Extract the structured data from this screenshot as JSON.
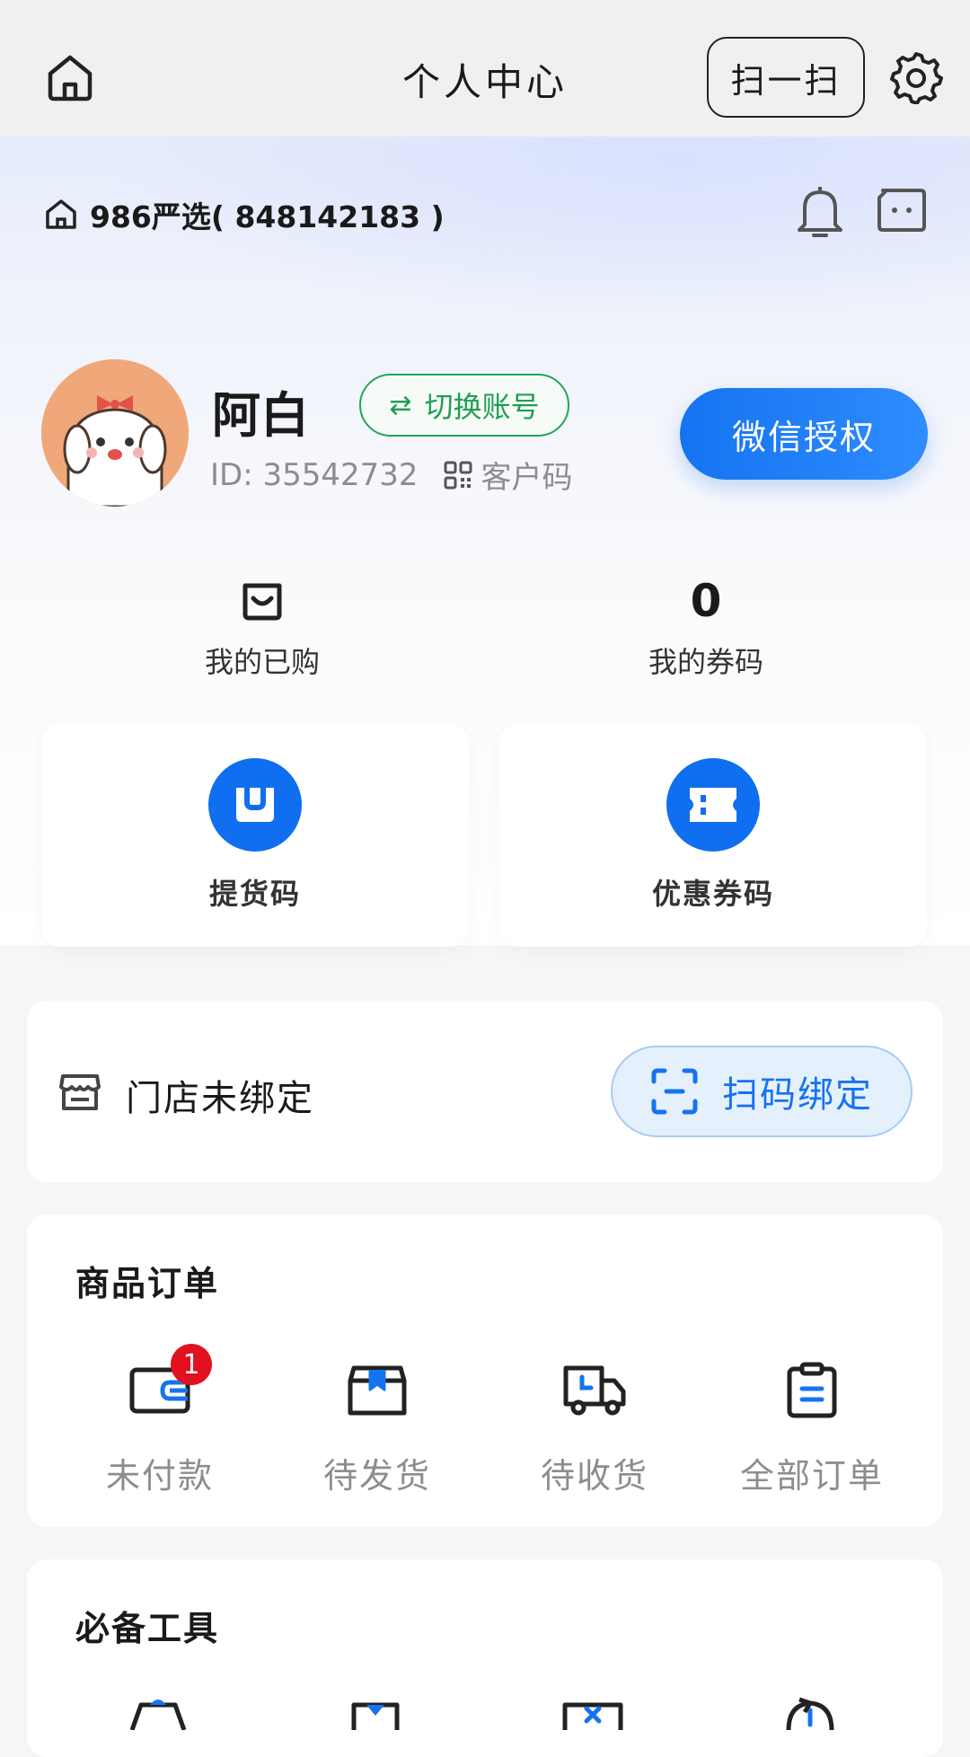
{
  "header": {
    "title": "个人中心",
    "scan_label": "扫一扫"
  },
  "shop": {
    "name": "986严选( 848142183 )"
  },
  "profile": {
    "name": "阿白",
    "switch_label": "切换账号",
    "id_text": "ID: 35542732",
    "customer_code_label": "客户码",
    "wechat_auth_label": "微信授权"
  },
  "stats": [
    {
      "value": "",
      "label": "我的已购",
      "icon": "shopping-bag-icon"
    },
    {
      "value": "0",
      "label": "我的券码"
    }
  ],
  "quick_cards": [
    {
      "label": "提货码",
      "icon": "pickup-code-icon"
    },
    {
      "label": "优惠券码",
      "icon": "coupon-ticket-icon"
    }
  ],
  "store": {
    "status": "门店未绑定",
    "bind_label": "扫码绑定"
  },
  "orders": {
    "title": "商品订单",
    "items": [
      {
        "label": "未付款",
        "icon": "wallet-icon",
        "badge": "1"
      },
      {
        "label": "待发货",
        "icon": "box-icon"
      },
      {
        "label": "待收货",
        "icon": "truck-icon"
      },
      {
        "label": "全部订单",
        "icon": "clipboard-icon"
      }
    ]
  },
  "tools": {
    "title": "必备工具"
  },
  "colors": {
    "primary": "#1474f0",
    "green": "#1f9e53",
    "badge": "#e2111f"
  }
}
